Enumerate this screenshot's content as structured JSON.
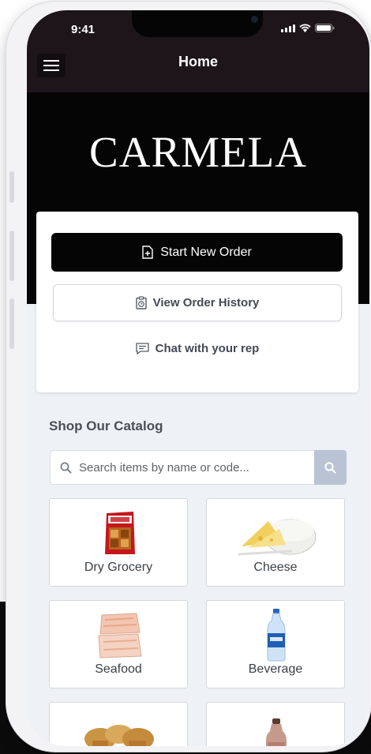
{
  "status_bar": {
    "time": "9:41"
  },
  "nav": {
    "title": "Home"
  },
  "brand": {
    "name": "CARMELA"
  },
  "actions": {
    "start_order": "Start New Order",
    "order_history": "View Order History",
    "chat": "Chat with your rep"
  },
  "catalog": {
    "title": "Shop Our Catalog",
    "search_placeholder": "Search items by name or code...",
    "categories": [
      {
        "label": "Dry Grocery",
        "icon": "dry-grocery-image"
      },
      {
        "label": "Cheese",
        "icon": "cheese-image"
      },
      {
        "label": "Seafood",
        "icon": "seafood-image"
      },
      {
        "label": "Beverage",
        "icon": "beverage-image"
      },
      {
        "label": "",
        "icon": "crackers-image"
      },
      {
        "label": "",
        "icon": "bottle-image"
      }
    ]
  },
  "colors": {
    "header": "#1d1519",
    "brand_band": "#050505",
    "primary_button": "#050505",
    "search_button": "#b9c3d3",
    "screen_bg": "#eef1f5"
  }
}
